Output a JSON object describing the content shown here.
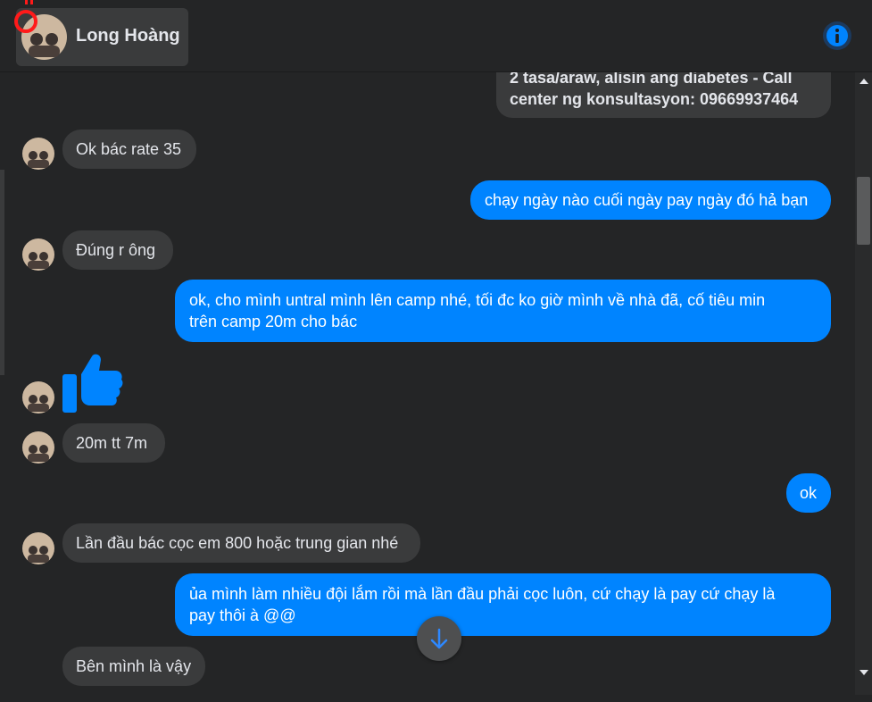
{
  "header": {
    "contact_name": "Long Hoàng"
  },
  "messages": [
    {
      "direction": "outgoing",
      "lines": [
        "2 tasa/araw, alisin ang diabetes - Call",
        "center ng konsultasyon: 09669937464"
      ]
    },
    {
      "direction": "incoming",
      "lines": [
        "Ok bác rate 35"
      ]
    },
    {
      "direction": "outgoing",
      "lines": [
        "chạy ngày nào cuối ngày pay ngày đó hả bạn"
      ]
    },
    {
      "direction": "incoming",
      "lines": [
        "Đúng r ông"
      ]
    },
    {
      "direction": "outgoing",
      "lines": [
        "ok, cho mình untral mình lên camp nhé, tối đc ko giờ mình về nhà đã, cố tiêu min",
        "trên camp 20m cho bác"
      ]
    },
    {
      "direction": "incoming",
      "type": "thumbs-up"
    },
    {
      "direction": "incoming",
      "lines": [
        "20m tt 7m"
      ]
    },
    {
      "direction": "outgoing",
      "lines": [
        "ok"
      ]
    },
    {
      "direction": "incoming",
      "lines": [
        "Lần đầu bác cọc em 800 hoặc trung gian nhé"
      ]
    },
    {
      "direction": "outgoing",
      "lines": [
        "ủa mình làm nhiều đội lắm rồi mà lần đầu phải cọc luôn, cứ chạy là pay cứ chạy là",
        "pay thôi à @@"
      ]
    },
    {
      "direction": "incoming",
      "lines": [
        "Bên mình là vậy"
      ]
    }
  ],
  "icons": {
    "info": "info-icon",
    "scroll_to_bottom": "arrow-down-icon",
    "like": "thumbs-up-icon"
  },
  "colors": {
    "background": "#242526",
    "incoming_bubble": "#3a3b3c",
    "outgoing_bubble": "#0084ff",
    "accent": "#0084ff",
    "text": "#e4e6eb"
  }
}
